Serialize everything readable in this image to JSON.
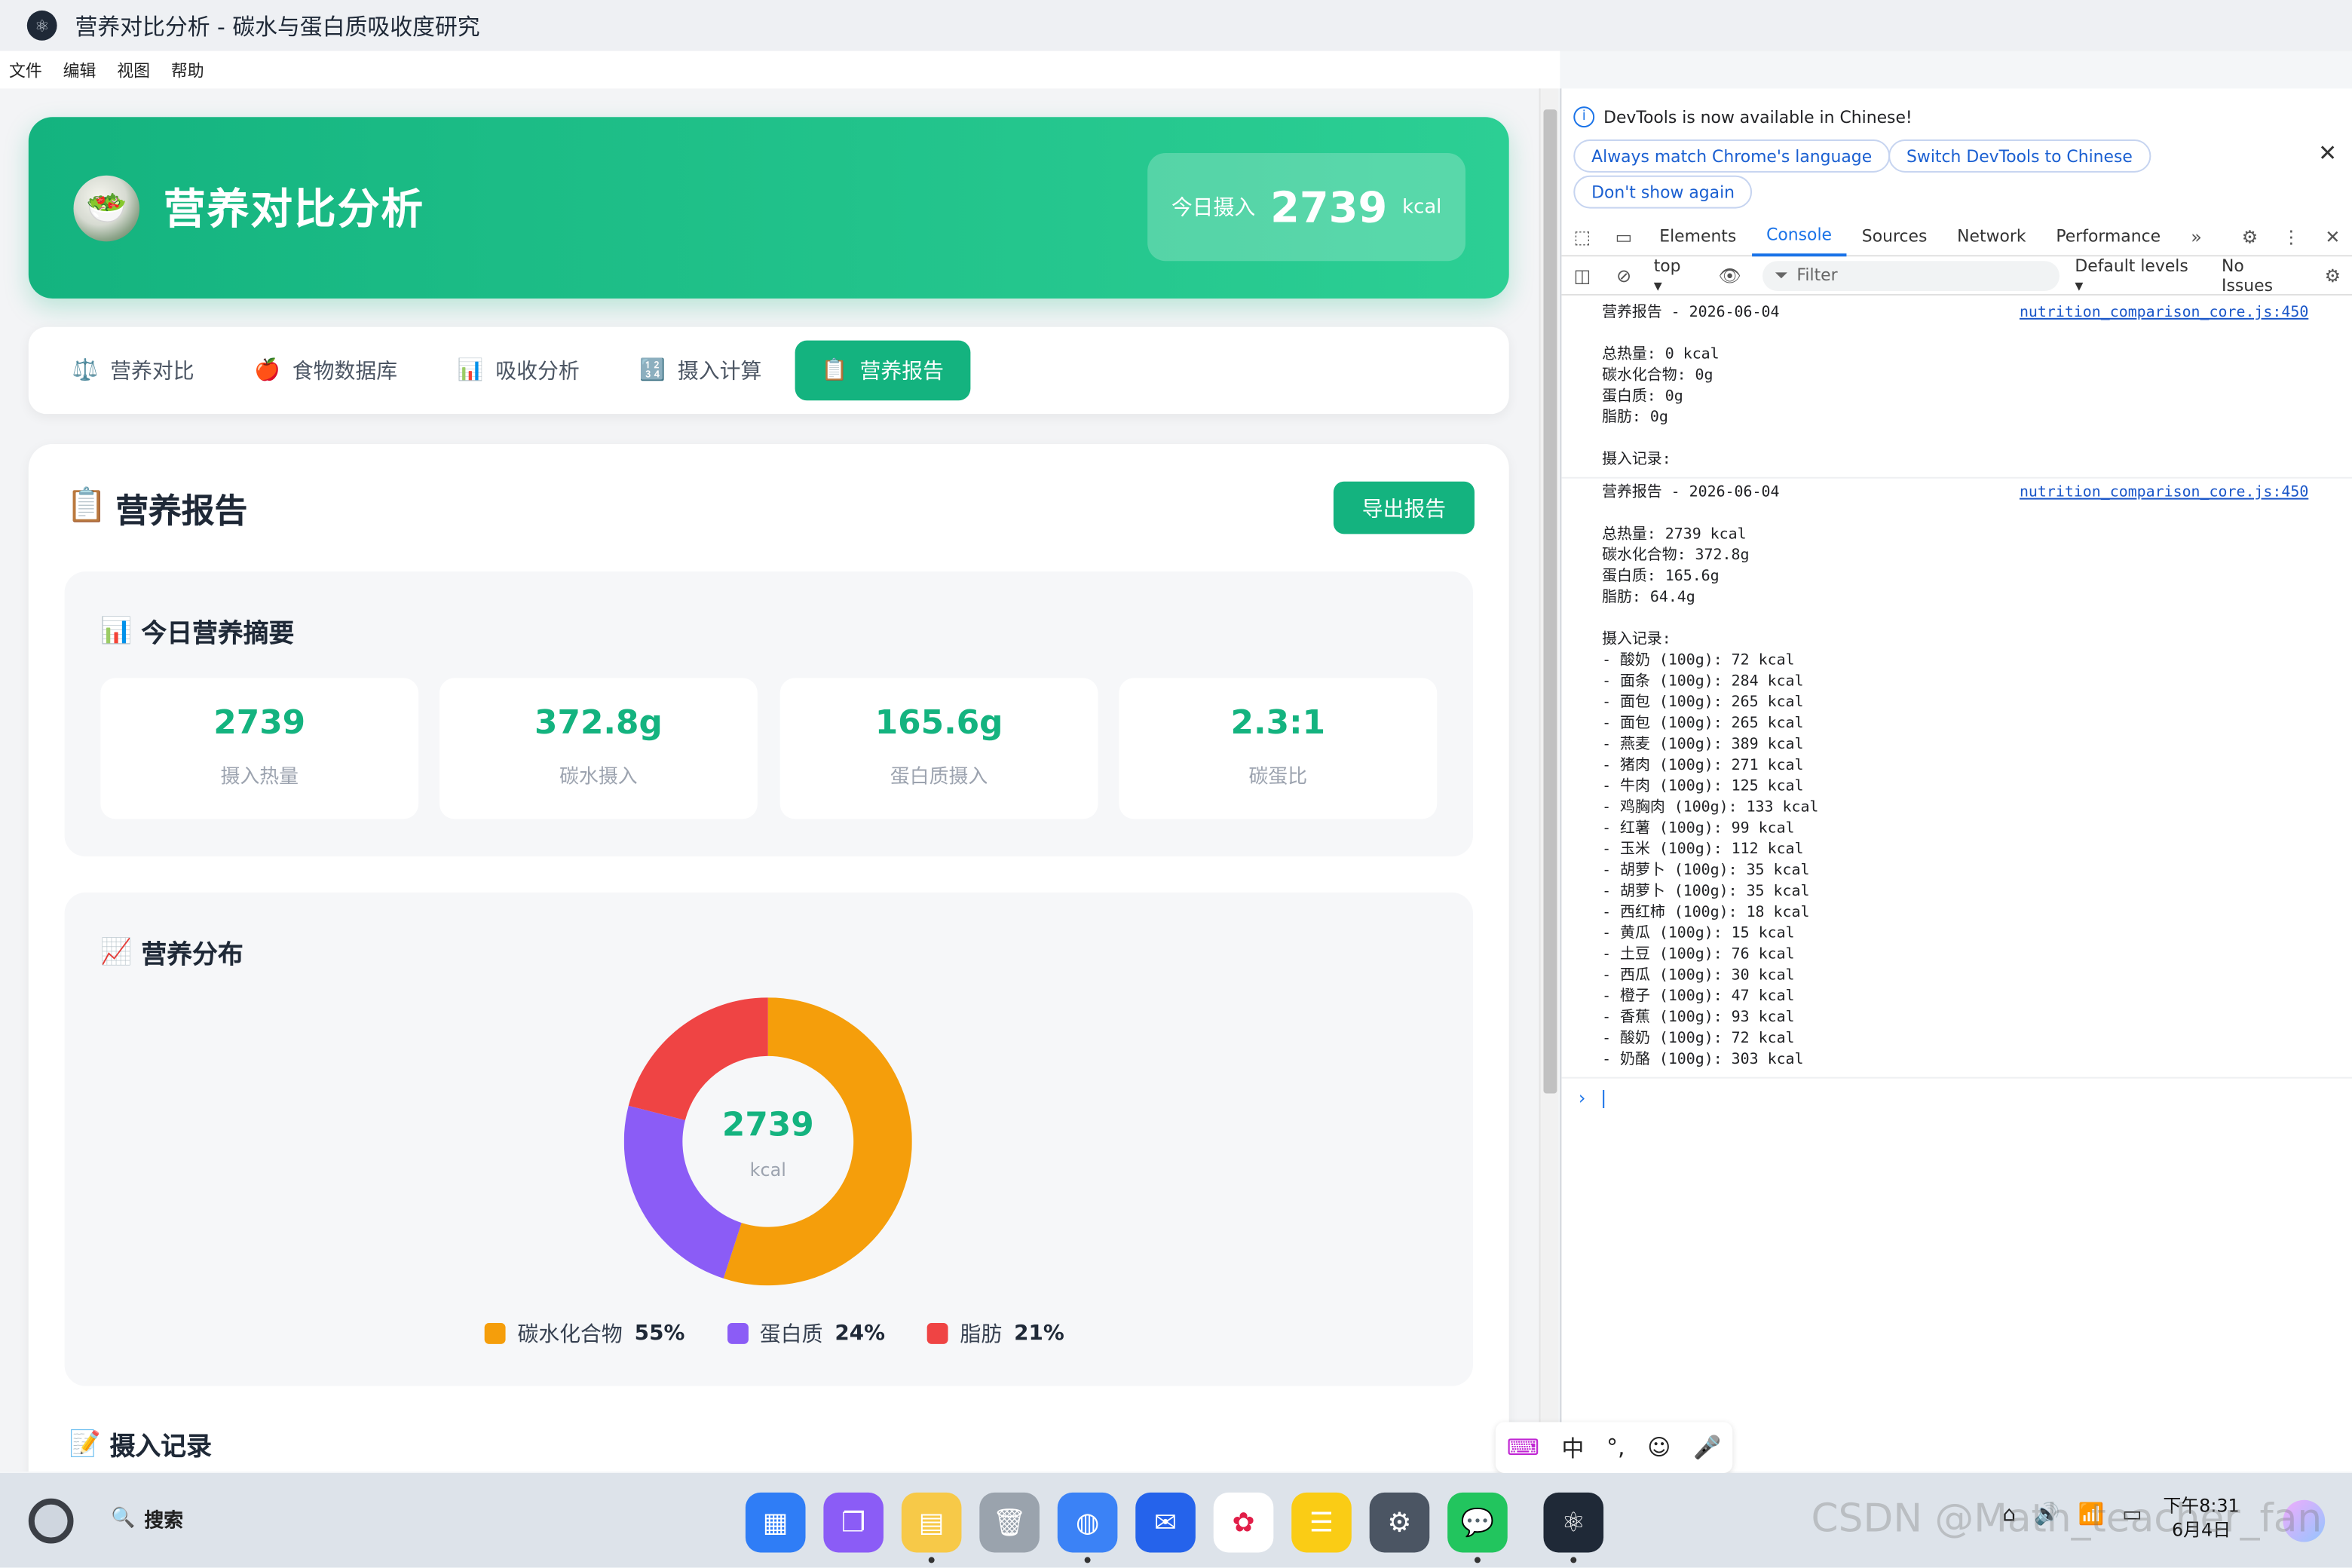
{
  "window": {
    "title": "营养对比分析 - 碳水与蛋白质吸收度研究"
  },
  "menu": [
    "文件",
    "编辑",
    "视图",
    "帮助"
  ],
  "hero": {
    "title": "营养对比分析",
    "badge_label": "今日摄入",
    "badge_value": "2739",
    "badge_unit": "kcal"
  },
  "tabs": [
    {
      "icon": "⚖️",
      "label": "营养对比"
    },
    {
      "icon": "🍎",
      "label": "食物数据库"
    },
    {
      "icon": "📊",
      "label": "吸收分析"
    },
    {
      "icon": "🔢",
      "label": "摄入计算"
    },
    {
      "icon": "📋",
      "label": "营养报告",
      "active": true
    }
  ],
  "report": {
    "title": "营养报告",
    "export_label": "导出报告",
    "summary_title": "今日营养摘要",
    "stats": [
      {
        "value": "2739",
        "label": "摄入热量"
      },
      {
        "value": "372.8g",
        "label": "碳水摄入"
      },
      {
        "value": "165.6g",
        "label": "蛋白质摄入"
      },
      {
        "value": "2.3:1",
        "label": "碳蛋比"
      }
    ],
    "distribution_title": "营养分布",
    "donut_center_value": "2739",
    "donut_center_unit": "kcal",
    "intake_title": "摄入记录"
  },
  "chart_data": {
    "type": "pie",
    "categories": [
      "碳水化合物",
      "蛋白质",
      "脂肪"
    ],
    "values": [
      55,
      24,
      21
    ],
    "colors": [
      "#f59e0b",
      "#8b5cf6",
      "#ef4444"
    ],
    "legend_labels": [
      "55%",
      "24%",
      "21%"
    ]
  },
  "devtools": {
    "info": "DevTools is now available in Chinese!",
    "pills": [
      "Always match Chrome's language",
      "Switch DevTools to Chinese",
      "Don't show again"
    ],
    "tabs": [
      "Elements",
      "Console",
      "Sources",
      "Network",
      "Performance"
    ],
    "active_tab": "Console",
    "context": "top",
    "filter_placeholder": "Filter",
    "levels": "Default levels",
    "issues": "No Issues",
    "logs": [
      {
        "source": "nutrition_comparison_core.js:450",
        "text": "营养报告 - 2026-06-04\n\n总热量: 0 kcal\n碳水化合物: 0g\n蛋白质: 0g\n脂肪: 0g\n\n摄入记录:"
      },
      {
        "source": "nutrition_comparison_core.js:450",
        "text": "营养报告 - 2026-06-04\n\n总热量: 2739 kcal\n碳水化合物: 372.8g\n蛋白质: 165.6g\n脂肪: 64.4g\n\n摄入记录:\n- 酸奶 (100g): 72 kcal\n- 面条 (100g): 284 kcal\n- 面包 (100g): 265 kcal\n- 面包 (100g): 265 kcal\n- 燕麦 (100g): 389 kcal\n- 猪肉 (100g): 271 kcal\n- 牛肉 (100g): 125 kcal\n- 鸡胸肉 (100g): 133 kcal\n- 红薯 (100g): 99 kcal\n- 玉米 (100g): 112 kcal\n- 胡萝卜 (100g): 35 kcal\n- 胡萝卜 (100g): 35 kcal\n- 西红柿 (100g): 18 kcal\n- 黄瓜 (100g): 15 kcal\n- 土豆 (100g): 76 kcal\n- 西瓜 (100g): 30 kcal\n- 橙子 (100g): 47 kcal\n- 香蕉 (100g): 93 kcal\n- 酸奶 (100g): 72 kcal\n- 奶酪 (100g): 303 kcal"
      }
    ]
  },
  "ime": [
    "中",
    "°,",
    "☺",
    "🎤"
  ],
  "taskbar": {
    "search": "搜索",
    "time": "下午8:31",
    "date": "6月4日",
    "watermark": "CSDN @Math_teacher_fan"
  }
}
